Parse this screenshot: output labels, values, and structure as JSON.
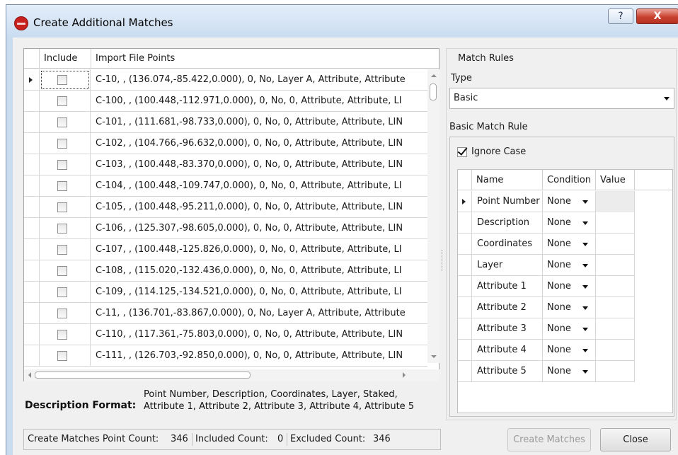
{
  "window": {
    "title": "Create Additional Matches",
    "help_label": "?",
    "close_label": "X"
  },
  "grid": {
    "headers": {
      "include": "Include",
      "points": "Import File Points"
    },
    "rows": [
      "C-10, , (136.074,-85.422,0.000), 0, No, Layer A, Attribute, Attribute",
      "C-100, , (100.448,-112.971,0.000), 0, No, 0, Attribute, Attribute, LI",
      "C-101, , (111.681,-98.733,0.000), 0, No, 0, Attribute, Attribute, LIN",
      "C-102, , (104.766,-96.632,0.000), 0, No, 0, Attribute, Attribute, LIN",
      "C-103, , (100.448,-83.370,0.000), 0, No, 0, Attribute, Attribute, LIN",
      "C-104, , (100.448,-109.747,0.000), 0, No, 0, Attribute, Attribute, LI",
      "C-105, , (100.448,-95.211,0.000), 0, No, 0, Attribute, Attribute, LIN",
      "C-106, , (125.307,-98.605,0.000), 0, No, 0, Attribute, Attribute, LIN",
      "C-107, , (100.448,-125.826,0.000), 0, No, 0, Attribute, Attribute, LI",
      "C-108, , (115.020,-132.436,0.000), 0, No, 0, Attribute, Attribute, LI",
      "C-109, , (114.125,-134.521,0.000), 0, No, 0, Attribute, Attribute, LI",
      "C-11, , (136.701,-83.867,0.000), 0, No, Layer A, Attribute, Attribute",
      "C-110, , (117.361,-75.803,0.000), 0, No, 0, Attribute, Attribute, LIN",
      "C-111, , (126.703,-92.850,0.000), 0, No, 0, Attribute, Attribute, LIN"
    ]
  },
  "description_format": {
    "label": "Description Format:",
    "line1": "Point Number, Description, Coordinates, Layer, Staked,",
    "line2": "Attribute 1, Attribute 2, Attribute 3, Attribute 4, Attribute 5"
  },
  "match_rules": {
    "title": "Match Rules",
    "type_label": "Type",
    "type_value": "Basic",
    "basic_label": "Basic Match Rule",
    "ignore_case_label": "Ignore Case",
    "ignore_case_checked": true,
    "headers": {
      "name": "Name",
      "condition": "Condition",
      "value": "Value"
    },
    "rows": [
      {
        "name": "Point Number",
        "condition": "None"
      },
      {
        "name": "Description",
        "condition": "None"
      },
      {
        "name": "Coordinates",
        "condition": "None"
      },
      {
        "name": "Layer",
        "condition": "None"
      },
      {
        "name": "Attribute 1",
        "condition": "None"
      },
      {
        "name": "Attribute 2",
        "condition": "None"
      },
      {
        "name": "Attribute 3",
        "condition": "None"
      },
      {
        "name": "Attribute 4",
        "condition": "None"
      },
      {
        "name": "Attribute 5",
        "condition": "None"
      }
    ]
  },
  "status": {
    "point_count_label": "Create Matches Point Count:",
    "point_count": "346",
    "included_label": "Included Count:",
    "included": "0",
    "excluded_label": "Excluded Count:",
    "excluded": "346"
  },
  "buttons": {
    "create_matches": "Create Matches",
    "close": "Close"
  }
}
